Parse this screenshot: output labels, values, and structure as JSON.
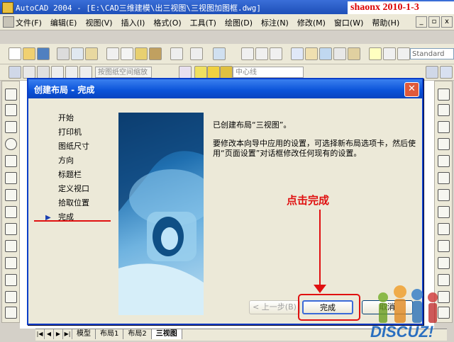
{
  "app": {
    "title": "AutoCAD 2004 - [E:\\CAD三维建模\\出三视图\\三视图加图框.dwg]",
    "watermark": "shaonx 2010-1-3"
  },
  "menubar": {
    "items": [
      "文件(F)",
      "编辑(E)",
      "视图(V)",
      "插入(I)",
      "格式(O)",
      "工具(T)",
      "绘图(D)",
      "标注(N)",
      "修改(M)",
      "窗口(W)",
      "帮助(H)"
    ],
    "window_buttons": [
      "_",
      "▫",
      "x"
    ]
  },
  "toolbar": {
    "text_style": "Standard",
    "viewport_scale": "按图纸空间缩放",
    "layer": "中心线"
  },
  "layout_tabs": {
    "items": [
      "模型",
      "布局1",
      "布局2",
      "三视图"
    ],
    "active": "三视图"
  },
  "dialog": {
    "title": "创建布局 - 完成",
    "steps": [
      "开始",
      "打印机",
      "图纸尺寸",
      "方向",
      "标题栏",
      "定义视口",
      "拾取位置",
      "完成"
    ],
    "current_step": "完成",
    "message_line1": "已创建布局“三视图”。",
    "message_line2": "要修改本向导中应用的设置，可选择新布局选项卡，然后使用“页面设置”对话框修改任何现有的设置。",
    "annotation": "点击完成",
    "buttons": {
      "prev": "< 上一步(B)",
      "finish": "完成",
      "cancel": "取消"
    }
  },
  "logo": {
    "text": "DISCUZ!"
  }
}
